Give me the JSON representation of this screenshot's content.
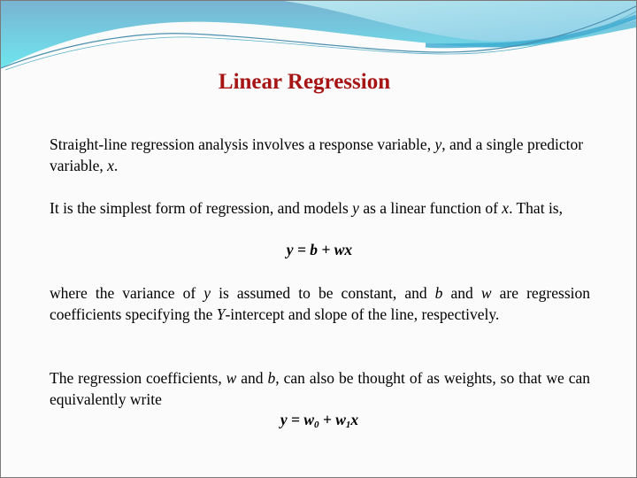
{
  "slide": {
    "title": "Linear Regression",
    "title_color": "#a61414",
    "paragraph1": {
      "before_y": "Straight-line regression analysis involves a response variable, ",
      "y": "y",
      "middle": ", and a single predictor variable, ",
      "x": "x",
      "end": "."
    },
    "paragraph2": {
      "before_y": "It is the simplest form of regression, and models ",
      "y": "y",
      "middle": " as a linear function of ",
      "x": "x",
      "end": ". That is,"
    },
    "formula1": "y = b + wx",
    "paragraph3": {
      "part1": "where the variance of ",
      "y": "y",
      "part2": " is assumed to be constant, and ",
      "b": "b",
      "part3": " and ",
      "w": "w",
      "part4": " are regression coefficients specifying the ",
      "Y": "Y",
      "part5": "-intercept and slope of the line, respectively."
    },
    "paragraph4": {
      "part1": "The regression coefficients, ",
      "w": "w",
      "part2": " and ",
      "b": "b",
      "part3": ", can also be thought of as weights, so that we can equivalently write"
    },
    "formula2": {
      "lhs": "y = w",
      "sub0": "0",
      "plus": " + w",
      "sub1": "1",
      "rhs": "x"
    }
  },
  "theme": {
    "wave_dark": "#6cb8d4",
    "wave_light": "#6ee3ec",
    "wave_right": "#a8dcea",
    "border": "#7a7a7a",
    "background": "#fbfbfb"
  }
}
